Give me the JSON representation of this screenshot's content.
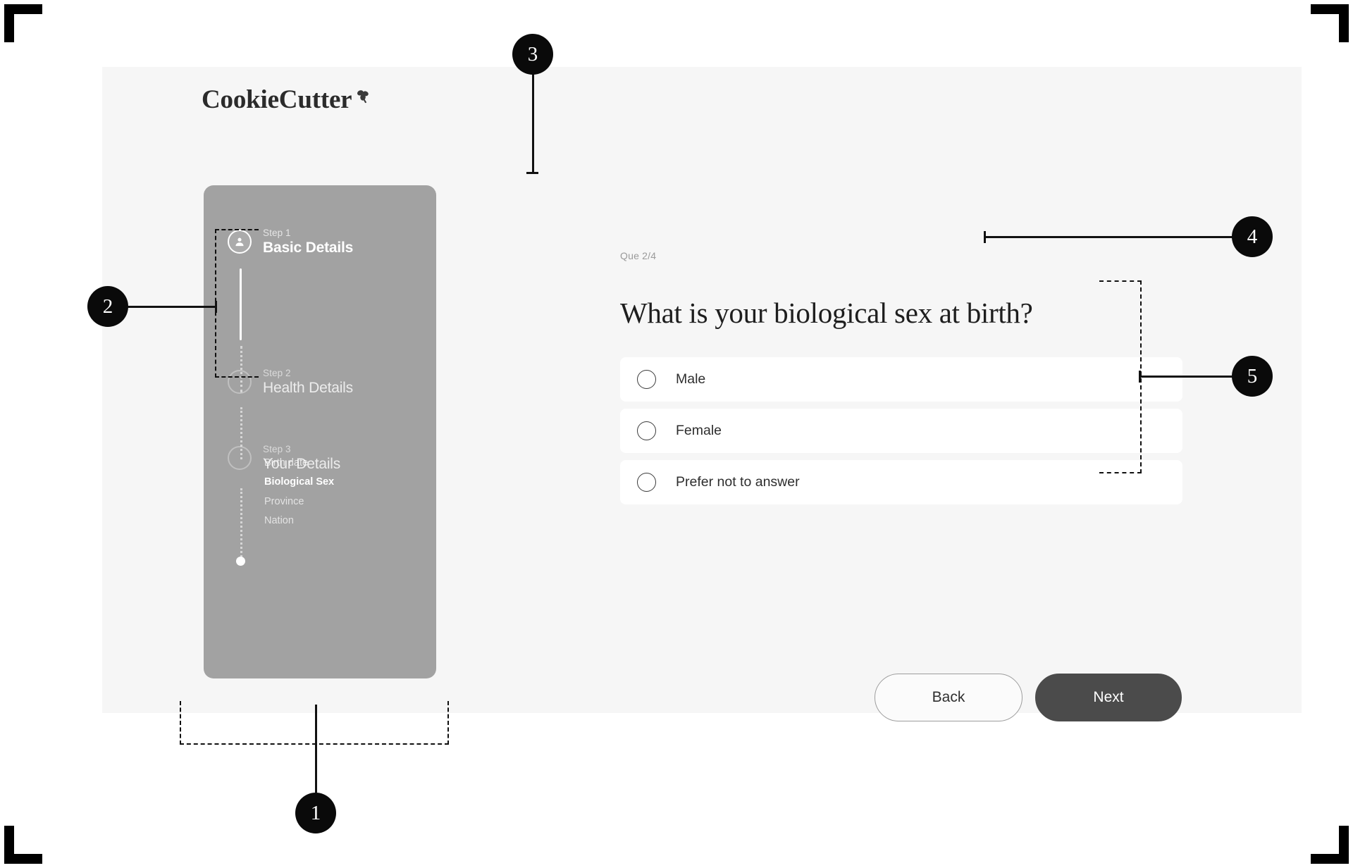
{
  "brand": {
    "name": "CookieCutter",
    "mark": "cookie-logo-mark"
  },
  "stepper": {
    "steps": [
      {
        "kicker": "Step 1",
        "title": "Basic Details",
        "state": "active",
        "icon": "user-avatar-icon"
      },
      {
        "kicker": "Step 2",
        "title": "Health Details",
        "state": "idle",
        "icon": "empty-circle-icon"
      },
      {
        "kicker": "Step 3",
        "title": "Your Details",
        "state": "idle",
        "icon": "empty-circle-icon"
      }
    ],
    "substeps": [
      {
        "label": "Birth date",
        "state": "done"
      },
      {
        "label": "Biological Sex",
        "state": "current"
      },
      {
        "label": "Province",
        "state": "todo"
      },
      {
        "label": "Nation",
        "state": "todo"
      }
    ]
  },
  "question": {
    "counter": "Que 2/4",
    "title": "What is your biological sex at birth?",
    "options": [
      {
        "label": "Male",
        "selected": false
      },
      {
        "label": "Female",
        "selected": false
      },
      {
        "label": "Prefer not to answer",
        "selected": false
      }
    ]
  },
  "actions": {
    "back_label": "Back",
    "next_label": "Next"
  },
  "annotations": [
    {
      "id": "1",
      "label": "1"
    },
    {
      "id": "2",
      "label": "2"
    },
    {
      "id": "3",
      "label": "3"
    },
    {
      "id": "4",
      "label": "4"
    },
    {
      "id": "5",
      "label": "5"
    }
  ],
  "colors": {
    "page_background": "#ffffff",
    "card_background": "#f6f6f6",
    "sidebar": "#a2a2a2",
    "primary_button": "#4b4b4b",
    "option_card": "#ffffff",
    "marker": "#0a0a0a",
    "muted_text": "#9a9a9a"
  }
}
